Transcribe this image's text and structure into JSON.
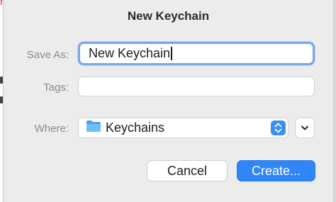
{
  "background": {
    "partial_text": "rusted",
    "accent_color": "#e0342e"
  },
  "dialog": {
    "title": "New Keychain",
    "save_as": {
      "label": "Save As:",
      "value": "New Keychain"
    },
    "tags": {
      "label": "Tags:",
      "value": ""
    },
    "where": {
      "label": "Where:",
      "selected": "Keychains",
      "icon": "folder-icon"
    },
    "buttons": {
      "cancel": "Cancel",
      "create": "Create..."
    },
    "colors": {
      "accent": "#2f86f6",
      "focus_ring": "#7aa8e6",
      "folder": "#5ab4f0"
    }
  }
}
